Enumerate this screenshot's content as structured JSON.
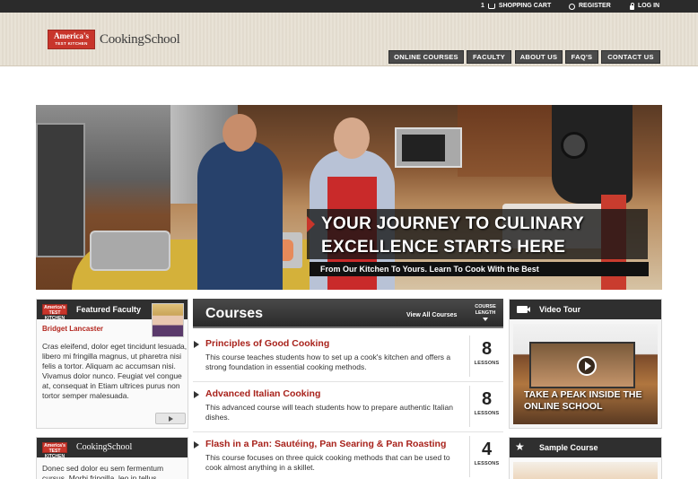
{
  "utility_bar": {
    "cart_count": "1",
    "cart_label": "SHOPPING CART",
    "register_label": "REGISTER",
    "login_label": "LOG IN"
  },
  "brand": {
    "logo_line1": "America's",
    "logo_line2": "TEST KITCHEN",
    "school_name": "CookingSchool",
    "color_red": "#c8352b"
  },
  "nav": {
    "items": [
      "ONLINE COURSES",
      "FACULTY",
      "ABOUT US",
      "FAQ'S",
      "CONTACT US"
    ]
  },
  "hero": {
    "headline_line1": "YOUR JOURNEY TO CULINARY",
    "headline_line2": "EXCELLENCE STARTS HERE",
    "subline": "From Our Kitchen To Yours.  Learn To Cook With the Best"
  },
  "featured_faculty": {
    "title": "Featured Faculty",
    "name": "Bridget Lancaster",
    "text": "Cras eleifend, dolor eget tincidunt lesuada, libero mi fringilla magnus, ut pharetra nisi felis a tortor. Aliquam ac accumsan nisi. Vivamus dolor nunco. Feugiat vel congue at, consequat in Etiam ultrices purus non tortor semper malesuada."
  },
  "school_box": {
    "title": "CookingSchool",
    "text": "Donec sed dolor eu sem fermentum cursus. Morbi fringilla, leo in tellus"
  },
  "courses": {
    "title": "Courses",
    "view_all": "View All Courses",
    "length_label_1": "COURSE",
    "length_label_2": "LENGTH",
    "items": [
      {
        "title": "Principles of Good Cooking",
        "desc": "This course teaches students how to set up a cook's kitchen and offers a strong foundation in essential cooking methods.",
        "lessons": "8",
        "lessons_label": "LESSONS"
      },
      {
        "title": "Advanced Italian Cooking",
        "desc": "This advanced course will teach students how to prepare authentic Italian dishes.",
        "lessons": "8",
        "lessons_label": "LESSONS"
      },
      {
        "title": "Flash in a Pan: Sautéing, Pan Searing & Pan Roasting",
        "desc": "This course focuses on three quick cooking methods that can be used to cook almost anything in a skillet.",
        "lessons": "4",
        "lessons_label": "LESSONS"
      }
    ]
  },
  "video_tour": {
    "title": "Video Tour",
    "caption_line1": "TAKE A PEAK INSIDE THE",
    "caption_line2": "ONLINE SCHOOL"
  },
  "sample_course": {
    "title": "Sample Course"
  }
}
